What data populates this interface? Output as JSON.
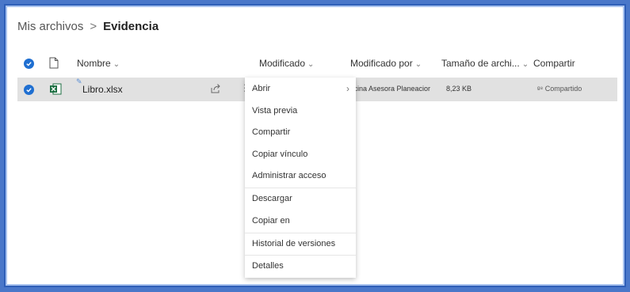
{
  "breadcrumb": {
    "root": "Mis archivos",
    "separator": ">",
    "current": "Evidencia"
  },
  "columns": {
    "name": "Nombre",
    "modified": "Modificado",
    "modified_by": "Modificado por",
    "size": "Tamaño de archi...",
    "share": "Compartir"
  },
  "row": {
    "name": "Libro.xlsx",
    "modified_by": "ficina Asesora Planeacior",
    "size": "8,23 KB",
    "share": "Compartido",
    "selected": true
  },
  "context_menu": {
    "items": [
      "Abrir",
      "Vista previa",
      "Compartir",
      "Copiar vínculo",
      "Administrar acceso",
      "Descargar",
      "Copiar en",
      "Historial de versiones",
      "Detalles"
    ]
  },
  "colors": {
    "accent": "#1f6fd1",
    "frame": "#4a77c9",
    "selected_row": "#e1e1e1",
    "excel": "#1d6f42"
  }
}
